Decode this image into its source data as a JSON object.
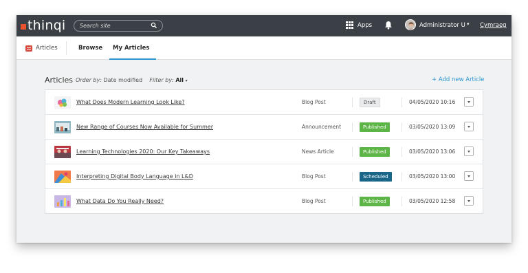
{
  "header": {
    "logo_text": "thinqi",
    "search_placeholder": "Search site",
    "apps_label": "Apps",
    "user_name": "Administrator U",
    "language_link": "Cymraeg",
    "accent_color": "#e8512d"
  },
  "subnav": {
    "section_label": "Articles",
    "tabs": [
      {
        "label": "Browse",
        "active": false
      },
      {
        "label": "My Articles",
        "active": true
      }
    ]
  },
  "content": {
    "title": "Articles",
    "order_by_label": "Order by:",
    "order_by_value": "Date modified",
    "filter_by_label": "Filter by:",
    "filter_by_value": "All",
    "add_button_label": "+ Add new Article"
  },
  "articles": [
    {
      "title": "What Does Modern Learning Look Like?",
      "type": "Blog Post",
      "status": "Draft",
      "date": "04/05/2020 10:16"
    },
    {
      "title": "New Range of Courses Now Available for Summer",
      "type": "Announcement",
      "status": "Published",
      "date": "03/05/2020 13:09"
    },
    {
      "title": "Learning Technologies 2020: Our Key Takeaways",
      "type": "News Article",
      "status": "Published",
      "date": "03/05/2020 13:06"
    },
    {
      "title": "Interpreting Digital Body Language in L&D",
      "type": "Blog Post",
      "status": "Scheduled",
      "date": "03/05/2020 13:00"
    },
    {
      "title": "What Data Do You Really Need?",
      "type": "Blog Post",
      "status": "Published",
      "date": "03/05/2020 12:58"
    }
  ],
  "colors": {
    "published": "#5cb546",
    "scheduled": "#1a6689",
    "draft": "#e9ebed",
    "link": "#2b96cf"
  }
}
